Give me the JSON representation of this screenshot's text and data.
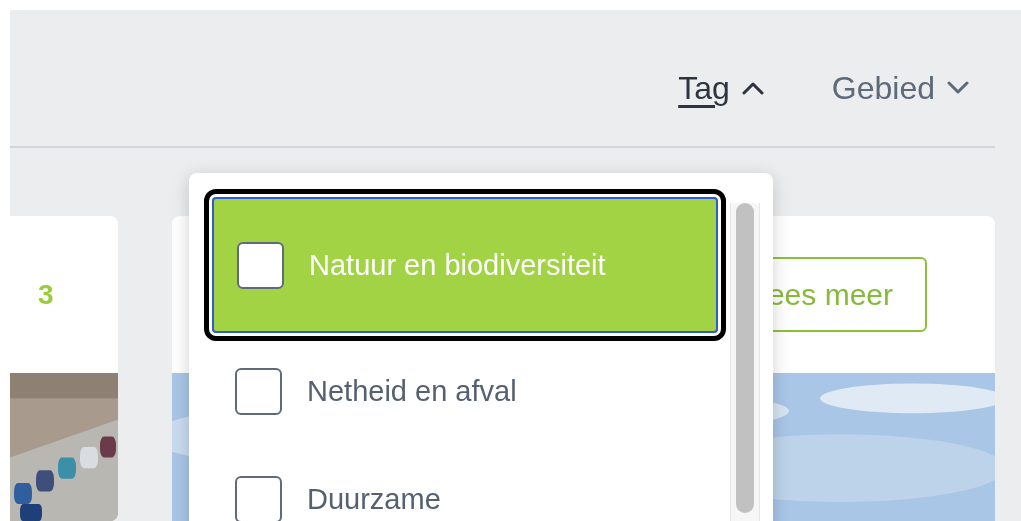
{
  "filters": [
    {
      "label": "Tag",
      "expanded": true
    },
    {
      "label": "Gebied",
      "expanded": false
    }
  ],
  "cards": [
    {
      "number": "3"
    },
    {
      "button": "ees meer"
    }
  ],
  "dropdown": {
    "options": [
      {
        "label": "Natuur en biodiversiteit",
        "checked": false,
        "highlighted": true
      },
      {
        "label": "Netheid en afval",
        "checked": false,
        "highlighted": false
      },
      {
        "label": "Duurzame",
        "checked": false,
        "highlighted": false
      }
    ]
  }
}
